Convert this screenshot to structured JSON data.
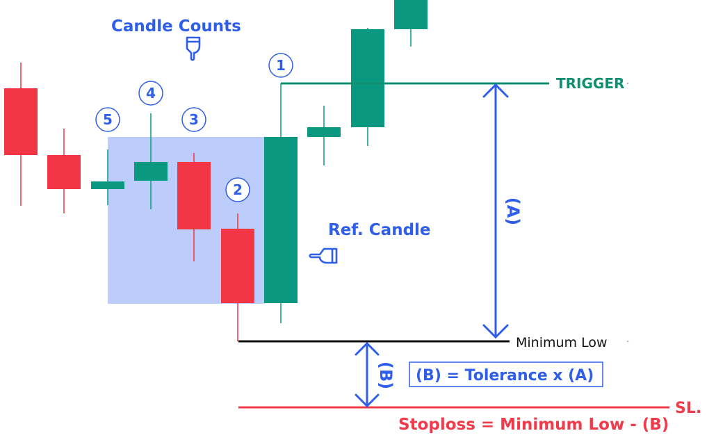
{
  "colors": {
    "bull": "#0a9980",
    "bear": "#f23645",
    "highlight": "#bccdfb",
    "blue": "#2f5ee8",
    "trigger": "#0f8f72",
    "stop": "#f03b4a",
    "min_low": "#111111"
  },
  "title": "Candle Counts",
  "ref_candle_label": "Ref. Candle",
  "count_labels": [
    "1",
    "2",
    "3",
    "4",
    "5"
  ],
  "levels": {
    "trigger": "TRIGGER",
    "minimum_low": "Minimum Low",
    "stoploss_short": "SL."
  },
  "measures": {
    "a_label": "(A)",
    "b_label": "(B)",
    "tolerance_formula": "(B) = Tolerance x (A)",
    "stoploss_formula": "Stoploss = Minimum Low - (B)"
  },
  "icons": {
    "pointing_down": "hand-pointing-down-icon",
    "pointing_left": "hand-pointing-left-icon"
  },
  "candles": [
    {
      "dir": "bear"
    },
    {
      "dir": "bear"
    },
    {
      "dir": "bull",
      "count": "5"
    },
    {
      "dir": "bull",
      "count": "4"
    },
    {
      "dir": "bear",
      "count": "3"
    },
    {
      "dir": "bear",
      "count": "2"
    },
    {
      "dir": "bull",
      "role": "reference"
    },
    {
      "dir": "bull"
    },
    {
      "dir": "bull",
      "count": "1"
    },
    {
      "dir": "bull"
    }
  ]
}
